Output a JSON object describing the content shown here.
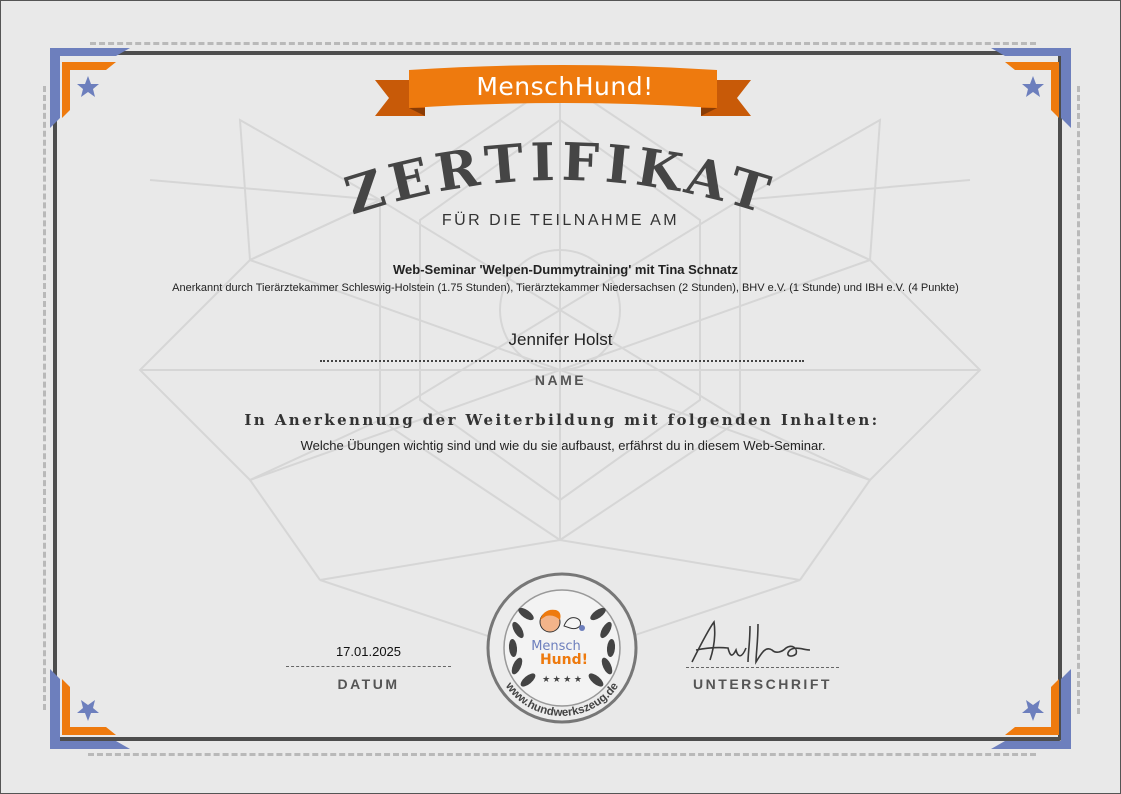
{
  "brand": {
    "banner_text": "MenschHund!"
  },
  "certificate": {
    "title": "ZERTIFIKAT",
    "subtitle": "FÜR DIE TEILNAHME AM",
    "seminar_title": "Web-Seminar 'Welpen-Dummytraining' mit Tina Schnatz",
    "accreditation": "Anerkannt durch Tierärztekammer Schleswig-Holstein (1.75 Stunden), Tierärztekammer Niedersachsen (2 Stunden), BHV e.V. (1 Stunde) und IBH e.V. (4 Punkte)",
    "participant_name": "Jennifer Holst",
    "name_label": "NAME",
    "recognition_heading": "In Anerkennung der Weiterbildung mit folgenden Inhalten:",
    "content_description": "Welche Übungen wichtig sind und wie du sie aufbaust, erfährst du in diesem Web-Seminar.",
    "date_value": "17.01.2025",
    "date_label": "DATUM",
    "signature_label": "UNTERSCHRIFT"
  },
  "seal": {
    "logo_line1": "Mensch",
    "logo_line2": "Hund!",
    "url": "www.hundwerkszeug.de",
    "stars": "★ ★ ★ ★"
  },
  "colors": {
    "orange": "#ee7a0e",
    "blue": "#6d7fbd",
    "dark": "#454545"
  }
}
